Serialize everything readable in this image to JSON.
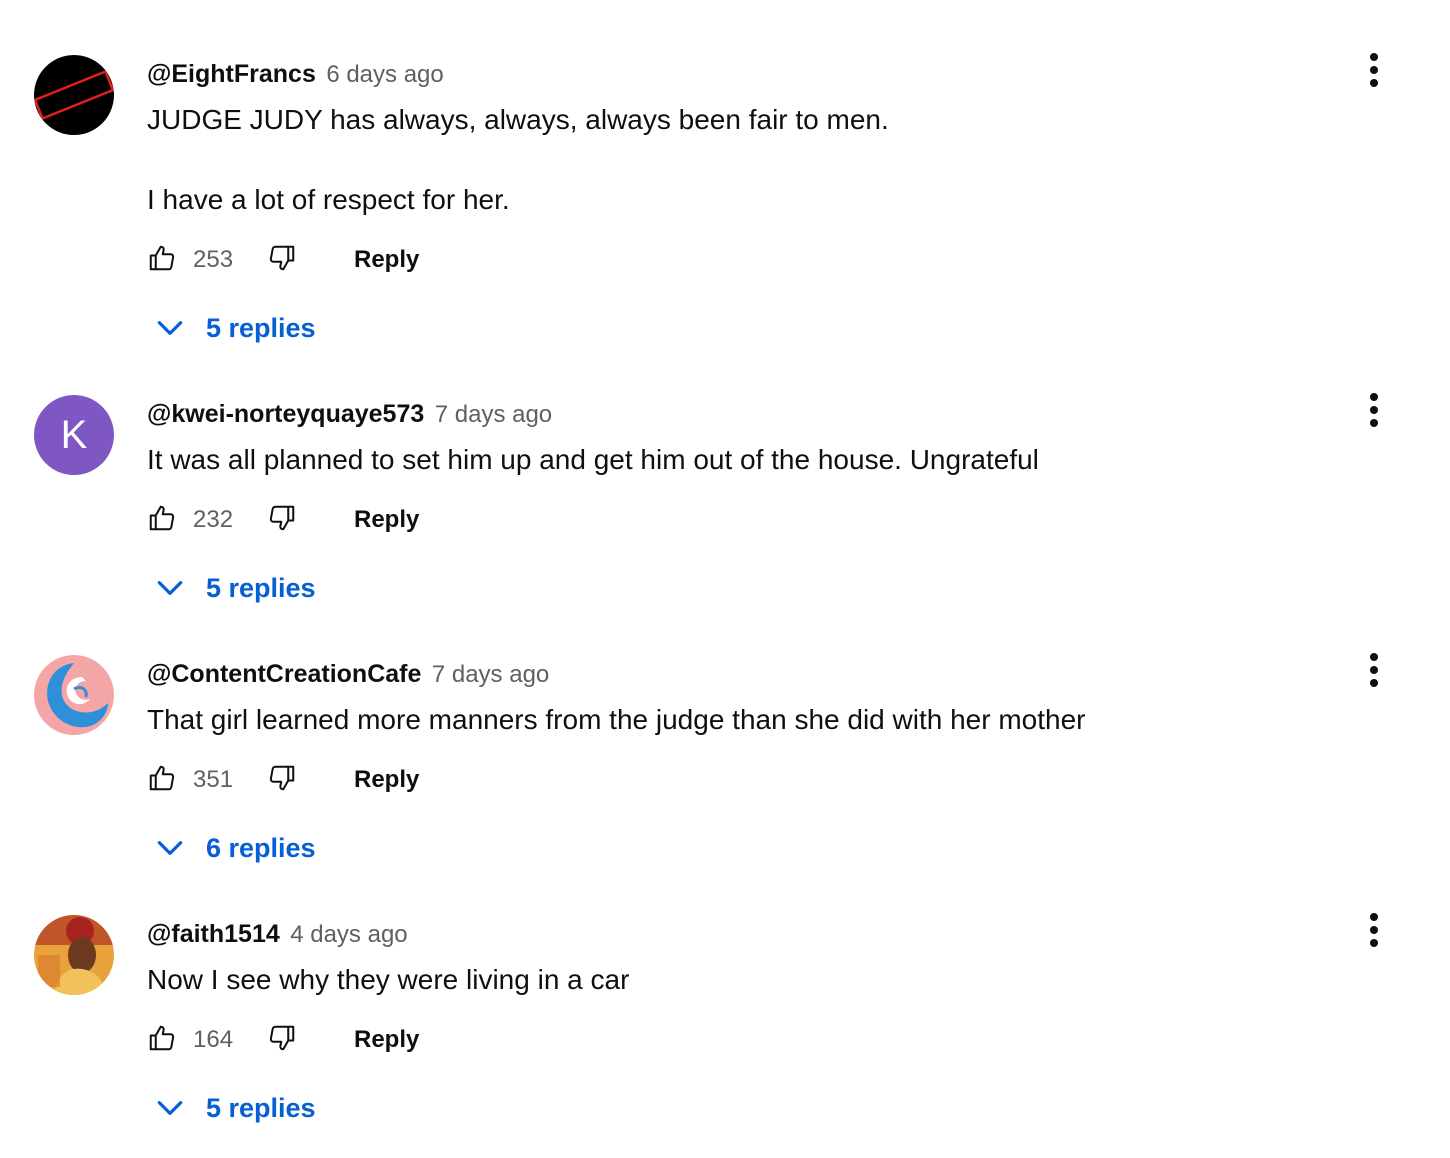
{
  "ui": {
    "reply_label": "Reply",
    "icons": {
      "like": "thumbs-up-icon",
      "dislike": "thumbs-down-icon",
      "expand": "chevron-down-icon",
      "menu": "more-vertical-icon"
    },
    "colors": {
      "link_blue": "#065fd4",
      "secondary_text": "#606060",
      "primary_text": "#0f0f0f"
    }
  },
  "comments": [
    {
      "author": "@EightFrancs",
      "time": "6 days ago",
      "text": "JUDGE JUDY has always, always, always been fair to men.\n\nI have a lot of respect for her.",
      "likes": "253",
      "replies": "5 replies",
      "avatar": {
        "type": "image",
        "label": "CENSORED"
      }
    },
    {
      "author": "@kwei-norteyquaye573",
      "time": "7 days ago",
      "text": "It was all planned to set him up and get him out of the house. Ungrateful",
      "likes": "232",
      "replies": "5 replies",
      "avatar": {
        "type": "letter",
        "letter": "K",
        "color": "#7e57c2"
      }
    },
    {
      "author": "@ContentCreationCafe",
      "time": "7 days ago",
      "text": "That girl learned more manners from the judge than she did with her mother",
      "likes": "351",
      "replies": "6 replies",
      "avatar": {
        "type": "image"
      }
    },
    {
      "author": "@faith1514",
      "time": "4 days ago",
      "text": "Now I see why they were living in a car",
      "likes": "164",
      "replies": "5 replies",
      "avatar": {
        "type": "image"
      }
    }
  ]
}
